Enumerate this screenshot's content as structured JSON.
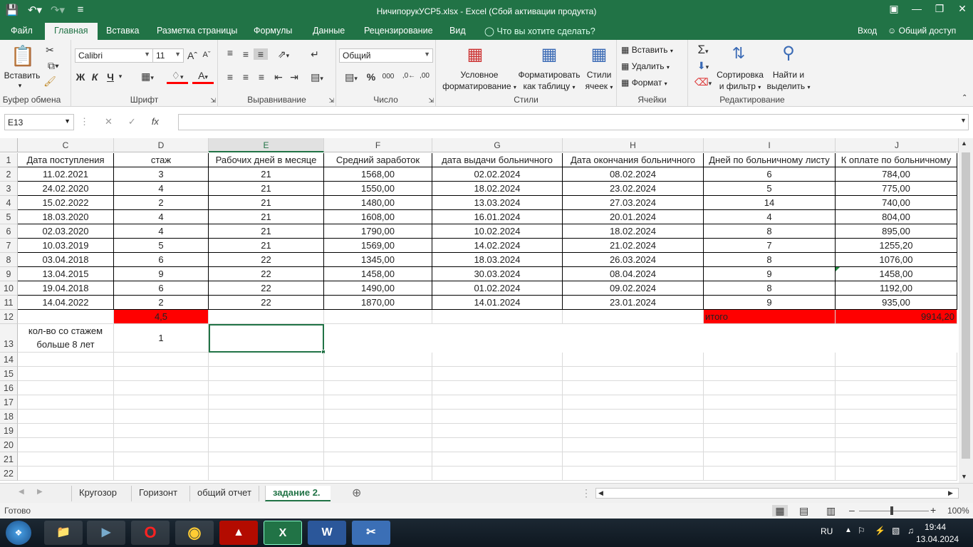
{
  "window": {
    "title": "НичипорукУСР5.xlsx - Excel (Сбой активации продукта)"
  },
  "menu": {
    "tabs": [
      "Файл",
      "Главная",
      "Вставка",
      "Разметка страницы",
      "Формулы",
      "Данные",
      "Рецензирование",
      "Вид"
    ],
    "tell_me": "Что вы хотите сделать?",
    "login": "Вход",
    "share": "Общий доступ"
  },
  "ribbon": {
    "clipboard": {
      "paste": "Вставить",
      "label": "Буфер обмена"
    },
    "font": {
      "name": "Calibri",
      "size": "11",
      "bold": "Ж",
      "italic": "К",
      "underline": "Ч",
      "label": "Шрифт"
    },
    "alignment": {
      "label": "Выравнивание"
    },
    "number": {
      "format": "Общий",
      "label": "Число"
    },
    "styles": {
      "conditional": "Условное",
      "conditional2": "форматирование",
      "table": "Форматировать",
      "table2": "как таблицу",
      "cell": "Стили",
      "cell2": "ячеек",
      "label": "Стили"
    },
    "cells": {
      "insert": "Вставить",
      "delete": "Удалить",
      "format": "Формат",
      "label": "Ячейки"
    },
    "editing": {
      "sort": "Сортировка",
      "sort2": "и фильтр",
      "find": "Найти и",
      "find2": "выделить",
      "label": "Редактирование"
    }
  },
  "formula_bar": {
    "name_box": "E13",
    "fx": "fx",
    "value": ""
  },
  "columns": [
    "C",
    "D",
    "E",
    "F",
    "G",
    "H",
    "I",
    "J"
  ],
  "rows": [
    "1",
    "2",
    "3",
    "4",
    "5",
    "6",
    "7",
    "8",
    "9",
    "10",
    "11",
    "12",
    "13",
    "14",
    "15",
    "16",
    "17",
    "18",
    "19",
    "20",
    "21",
    "22"
  ],
  "header_row": [
    "Дата поступления",
    "стаж",
    "Рабочих дней в месяце",
    "Средний заработок",
    "дата выдачи больничного",
    "Дата окончания больничного",
    "Дней по больничному листу",
    "К оплате по больничному"
  ],
  "table": [
    [
      "11.02.2021",
      "3",
      "21",
      "1568,00",
      "02.02.2024",
      "08.02.2024",
      "6",
      "784,00"
    ],
    [
      "24.02.2020",
      "4",
      "21",
      "1550,00",
      "18.02.2024",
      "23.02.2024",
      "5",
      "775,00"
    ],
    [
      "15.02.2022",
      "2",
      "21",
      "1480,00",
      "13.03.2024",
      "27.03.2024",
      "14",
      "740,00"
    ],
    [
      "18.03.2020",
      "4",
      "21",
      "1608,00",
      "16.01.2024",
      "20.01.2024",
      "4",
      "804,00"
    ],
    [
      "02.03.2020",
      "4",
      "21",
      "1790,00",
      "10.02.2024",
      "18.02.2024",
      "8",
      "895,00"
    ],
    [
      "10.03.2019",
      "5",
      "21",
      "1569,00",
      "14.02.2024",
      "21.02.2024",
      "7",
      "1255,20"
    ],
    [
      "03.04.2018",
      "6",
      "22",
      "1345,00",
      "18.03.2024",
      "26.03.2024",
      "8",
      "1076,00"
    ],
    [
      "13.04.2015",
      "9",
      "22",
      "1458,00",
      "30.03.2024",
      "08.04.2024",
      "9",
      "1458,00"
    ],
    [
      "19.04.2018",
      "6",
      "22",
      "1490,00",
      "01.02.2024",
      "09.02.2024",
      "8",
      "1192,00"
    ],
    [
      "14.04.2022",
      "2",
      "22",
      "1870,00",
      "14.01.2024",
      "23.01.2024",
      "9",
      "935,00"
    ]
  ],
  "row12": {
    "avg_stazh": "4,5",
    "itogo_label": "итого",
    "itogo_value": "9914,20"
  },
  "row13": {
    "label_line1": "кол-во со стажем",
    "label_line2": "больше 8 лет",
    "value": "1"
  },
  "sheets": [
    "Кругозор",
    "Горизонт",
    "общий отчет",
    "задание 2."
  ],
  "active_sheet": "задание 2.",
  "status": {
    "ready": "Готово",
    "zoom": "100%"
  },
  "taskbar": {
    "lang": "RU",
    "time": "19:44",
    "date": "13.04.2024"
  },
  "colors": {
    "excel_green": "#217346",
    "highlight_red": "#ff0000"
  }
}
